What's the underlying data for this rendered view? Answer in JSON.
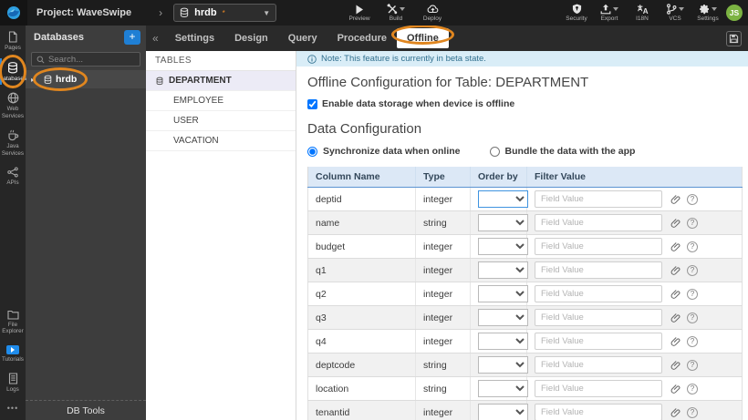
{
  "topbar": {
    "project_label": "Project: WaveSwipe",
    "db_selector_value": "hrdb",
    "modified_marker": "*",
    "preview_label": "Preview",
    "build_label": "Build",
    "deploy_label": "Deploy",
    "security_label": "Security",
    "export_label": "Export",
    "i18n_label": "I18N",
    "vcs_label": "VCS",
    "settings_label": "Settings",
    "avatar_initials": "JS"
  },
  "sidebar": {
    "items": [
      {
        "label": "Pages"
      },
      {
        "label": "Databases",
        "active": true
      },
      {
        "label": "Web Services"
      },
      {
        "label": "Java Services"
      },
      {
        "label": "APIs"
      }
    ],
    "lower_items": [
      {
        "label": "File Explorer"
      },
      {
        "label": "Tutorials"
      },
      {
        "label": "Logs"
      }
    ],
    "more_label": "•••"
  },
  "db_panel": {
    "title": "Databases",
    "add_button": "+",
    "search_placeholder": "Search...",
    "items": [
      {
        "label": "hrdb"
      }
    ],
    "footer": "DB Tools"
  },
  "tab_bar": {
    "collapse_glyph": "«",
    "tabs": [
      {
        "label": "Settings"
      },
      {
        "label": "Design"
      },
      {
        "label": "Query"
      },
      {
        "label": "Procedure"
      },
      {
        "label": "Offline",
        "active": true
      }
    ]
  },
  "tables_panel": {
    "title": "TABLES",
    "items": [
      {
        "label": "DEPARTMENT",
        "selected": true
      },
      {
        "label": "EMPLOYEE"
      },
      {
        "label": "USER"
      },
      {
        "label": "VACATION"
      }
    ]
  },
  "main": {
    "note": "Note: This feature is currently in beta state.",
    "title": "Offline Configuration for Table: DEPARTMENT",
    "enable_checkbox_label": "Enable data storage when device is offline",
    "enable_checkbox_checked": true,
    "section_title": "Data Configuration",
    "radio_options": [
      {
        "label": "Synchronize data when online",
        "selected": true
      },
      {
        "label": "Bundle the data with the app",
        "selected": false
      }
    ],
    "config_table": {
      "headers": [
        "Column Name",
        "Type",
        "Order by",
        "Filter Value"
      ],
      "filter_placeholder": "Field Value",
      "rows": [
        {
          "column": "deptid",
          "type": "integer"
        },
        {
          "column": "name",
          "type": "string"
        },
        {
          "column": "budget",
          "type": "integer"
        },
        {
          "column": "q1",
          "type": "integer"
        },
        {
          "column": "q2",
          "type": "integer"
        },
        {
          "column": "q3",
          "type": "integer"
        },
        {
          "column": "q4",
          "type": "integer"
        },
        {
          "column": "deptcode",
          "type": "string"
        },
        {
          "column": "location",
          "type": "string"
        },
        {
          "column": "tenantid",
          "type": "integer"
        }
      ]
    }
  },
  "colors": {
    "annotation_orange": "#e0861f",
    "accent_blue": "#1f7fd4",
    "note_bg": "#d9edf7",
    "note_text": "#31708f",
    "table_header_bg": "#dce8f6",
    "selected_row_bg": "#ecebf6",
    "avatar_green": "#7cb342"
  }
}
